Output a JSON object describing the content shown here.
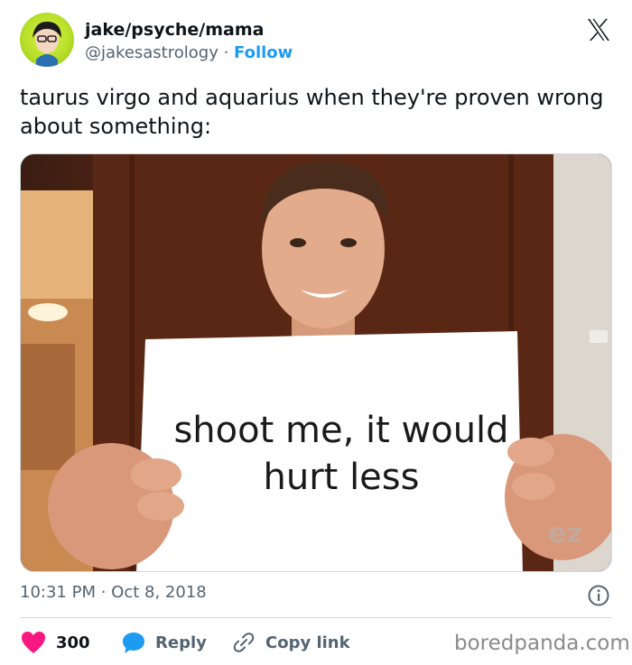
{
  "header": {
    "display_name": "jake/psyche/mama",
    "handle": "@jakesastrology",
    "separator": " · ",
    "follow_label": "Follow"
  },
  "tweet": {
    "text": "taurus virgo and aquarius when they're proven wrong about something:",
    "image_caption_line1": "shoot me, it would",
    "image_caption_line2": "hurt less",
    "watermark": "ez",
    "time": "10:31 PM",
    "dot": " · ",
    "date": "Oct 8, 2018"
  },
  "actions": {
    "like_count": "300",
    "reply_label": "Reply",
    "copy_label": "Copy link"
  },
  "footer": {
    "brand": "boredpanda.com"
  },
  "colors": {
    "accent": "#1d9bf0",
    "like": "#f91880",
    "text": "#0f1419",
    "muted": "#536471"
  },
  "icons": [
    "x-logo-icon",
    "info-icon",
    "heart-icon",
    "reply-bubble-icon",
    "link-icon"
  ]
}
